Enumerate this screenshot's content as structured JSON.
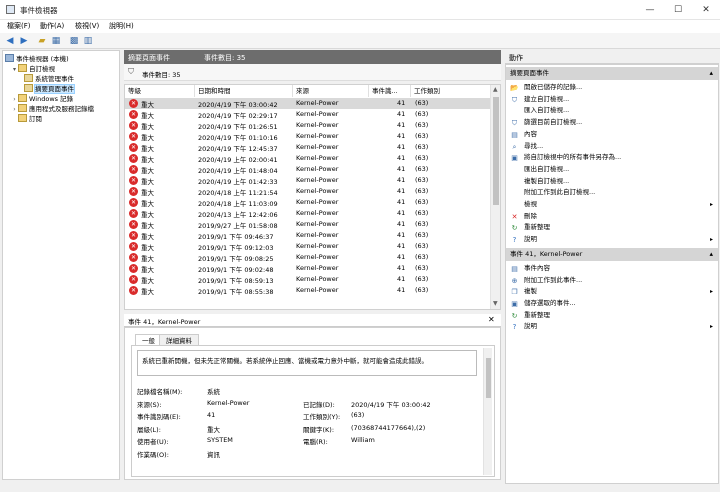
{
  "window": {
    "title": "事件檢視器"
  },
  "menu": [
    "檔案(F)",
    "動作(A)",
    "檢視(V)",
    "說明(H)"
  ],
  "tree": {
    "root": "事件檢視器 (本機)",
    "items": [
      {
        "label": "自訂檢視",
        "level": 1,
        "exp": "▾"
      },
      {
        "label": "系統管理事件",
        "level": 2,
        "exp": ""
      },
      {
        "label": "摘要頁面事件",
        "level": 2,
        "exp": "",
        "selected": true
      },
      {
        "label": "Windows 記錄",
        "level": 1,
        "exp": "›"
      },
      {
        "label": "應用程式及服務記錄檔",
        "level": 1,
        "exp": "›"
      },
      {
        "label": "訂閱",
        "level": 1,
        "exp": ""
      }
    ]
  },
  "main": {
    "header_title": "摘要頁面事件",
    "header_count": "事件數目: 35",
    "filter_text": "事件數目: 35",
    "columns": [
      "等級",
      "日期和時間",
      "來源",
      "事件識...",
      "工作類別"
    ],
    "rows": [
      {
        "level": "重大",
        "datetime": "2020/4/19 下午 03:00:42",
        "source": "Kernel-Power",
        "id": "41",
        "task": "(63)"
      },
      {
        "level": "重大",
        "datetime": "2020/4/19 下午 02:29:17",
        "source": "Kernel-Power",
        "id": "41",
        "task": "(63)"
      },
      {
        "level": "重大",
        "datetime": "2020/4/19 下午 01:26:51",
        "source": "Kernel-Power",
        "id": "41",
        "task": "(63)"
      },
      {
        "level": "重大",
        "datetime": "2020/4/19 下午 01:10:16",
        "source": "Kernel-Power",
        "id": "41",
        "task": "(63)"
      },
      {
        "level": "重大",
        "datetime": "2020/4/19 下午 12:45:37",
        "source": "Kernel-Power",
        "id": "41",
        "task": "(63)"
      },
      {
        "level": "重大",
        "datetime": "2020/4/19 上午 02:00:41",
        "source": "Kernel-Power",
        "id": "41",
        "task": "(63)"
      },
      {
        "level": "重大",
        "datetime": "2020/4/19 上午 01:48:04",
        "source": "Kernel-Power",
        "id": "41",
        "task": "(63)"
      },
      {
        "level": "重大",
        "datetime": "2020/4/19 上午 01:42:33",
        "source": "Kernel-Power",
        "id": "41",
        "task": "(63)"
      },
      {
        "level": "重大",
        "datetime": "2020/4/18 上午 11:21:54",
        "source": "Kernel-Power",
        "id": "41",
        "task": "(63)"
      },
      {
        "level": "重大",
        "datetime": "2020/4/18 上午 11:03:09",
        "source": "Kernel-Power",
        "id": "41",
        "task": "(63)"
      },
      {
        "level": "重大",
        "datetime": "2020/4/13 上午 12:42:06",
        "source": "Kernel-Power",
        "id": "41",
        "task": "(63)"
      },
      {
        "level": "重大",
        "datetime": "2019/9/27 上午 01:58:08",
        "source": "Kernel-Power",
        "id": "41",
        "task": "(63)"
      },
      {
        "level": "重大",
        "datetime": "2019/9/1 下午 09:46:37",
        "source": "Kernel-Power",
        "id": "41",
        "task": "(63)"
      },
      {
        "level": "重大",
        "datetime": "2019/9/1 下午 09:12:03",
        "source": "Kernel-Power",
        "id": "41",
        "task": "(63)"
      },
      {
        "level": "重大",
        "datetime": "2019/9/1 下午 09:08:25",
        "source": "Kernel-Power",
        "id": "41",
        "task": "(63)"
      },
      {
        "level": "重大",
        "datetime": "2019/9/1 下午 09:02:48",
        "source": "Kernel-Power",
        "id": "41",
        "task": "(63)"
      },
      {
        "level": "重大",
        "datetime": "2019/9/1 下午 08:59:13",
        "source": "Kernel-Power",
        "id": "41",
        "task": "(63)"
      },
      {
        "level": "重大",
        "datetime": "2019/9/1 下午 08:55:38",
        "source": "Kernel-Power",
        "id": "41",
        "task": "(63)"
      }
    ]
  },
  "detail": {
    "header": "事件 41，Kernel-Power",
    "tabs": [
      "一般",
      "詳細資料"
    ],
    "message": "系統已重新開機，但未先正常關機。若系統停止回應、當機或電力意外中斷，就可能會造成此錯誤。",
    "fields_left": [
      {
        "label": "記錄檔名稱(M):",
        "value": "系統"
      },
      {
        "label": "來源(S):",
        "value": "Kernel-Power"
      },
      {
        "label": "事件識別碼(E):",
        "value": "41"
      },
      {
        "label": "層級(L):",
        "value": "重大"
      },
      {
        "label": "使用者(U):",
        "value": "SYSTEM"
      },
      {
        "label": "作業碼(O):",
        "value": "資訊"
      }
    ],
    "fields_right": [
      {
        "label": "已記錄(D):",
        "value": "2020/4/19 下午 03:00:42"
      },
      {
        "label": "工作類別(Y):",
        "value": "(63)"
      },
      {
        "label": "關鍵字(K):",
        "value": "(70368744177664),(2)"
      },
      {
        "label": "電腦(R):",
        "value": "William"
      }
    ]
  },
  "actions": {
    "header": "動作",
    "section1": "摘要頁面事件",
    "items1": [
      {
        "label": "開啟已儲存的記錄...",
        "icon": "open-folder-icon",
        "glyph": "📂"
      },
      {
        "label": "建立自訂檢視...",
        "icon": "filter-create-icon",
        "glyph": "⛉"
      },
      {
        "label": "匯入自訂檢視...",
        "icon": "",
        "glyph": ""
      },
      {
        "label": "篩選目前自訂檢視...",
        "icon": "filter-icon",
        "glyph": "⛉"
      },
      {
        "label": "內容",
        "icon": "properties-icon",
        "glyph": "▤"
      },
      {
        "label": "尋找...",
        "icon": "find-icon",
        "glyph": "⌕"
      },
      {
        "label": "將自訂檢視中的所有事件另存為...",
        "icon": "save-icon",
        "glyph": "▣"
      },
      {
        "label": "匯出自訂檢視...",
        "icon": "",
        "glyph": ""
      },
      {
        "label": "複製自訂檢視...",
        "icon": "",
        "glyph": ""
      },
      {
        "label": "附加工作到此自訂檢視...",
        "icon": "",
        "glyph": ""
      },
      {
        "label": "檢視",
        "icon": "",
        "glyph": "",
        "submenu": "▸"
      },
      {
        "label": "刪除",
        "icon": "delete-icon",
        "glyph": "✕"
      },
      {
        "label": "重新整理",
        "icon": "refresh-icon",
        "glyph": "↻"
      },
      {
        "label": "說明",
        "icon": "help-icon",
        "glyph": "?",
        "submenu": "▸"
      }
    ],
    "section2": "事件 41，Kernel-Power",
    "items2": [
      {
        "label": "事件內容",
        "icon": "event-properties-icon",
        "glyph": "▤"
      },
      {
        "label": "附加工作到此事件...",
        "icon": "attach-task-icon",
        "glyph": "⊕"
      },
      {
        "label": "複製",
        "icon": "copy-icon",
        "glyph": "❐",
        "submenu": "▸"
      },
      {
        "label": "儲存選取的事件...",
        "icon": "save-icon",
        "glyph": "▣"
      },
      {
        "label": "重新整理",
        "icon": "refresh-icon",
        "glyph": "↻"
      },
      {
        "label": "說明",
        "icon": "help-icon",
        "glyph": "?",
        "submenu": "▸"
      }
    ]
  },
  "colors": {
    "error": "#d92b2b",
    "section": "#d5d5d5",
    "header": "#6d6d6d",
    "selection": "#cce8ff"
  }
}
